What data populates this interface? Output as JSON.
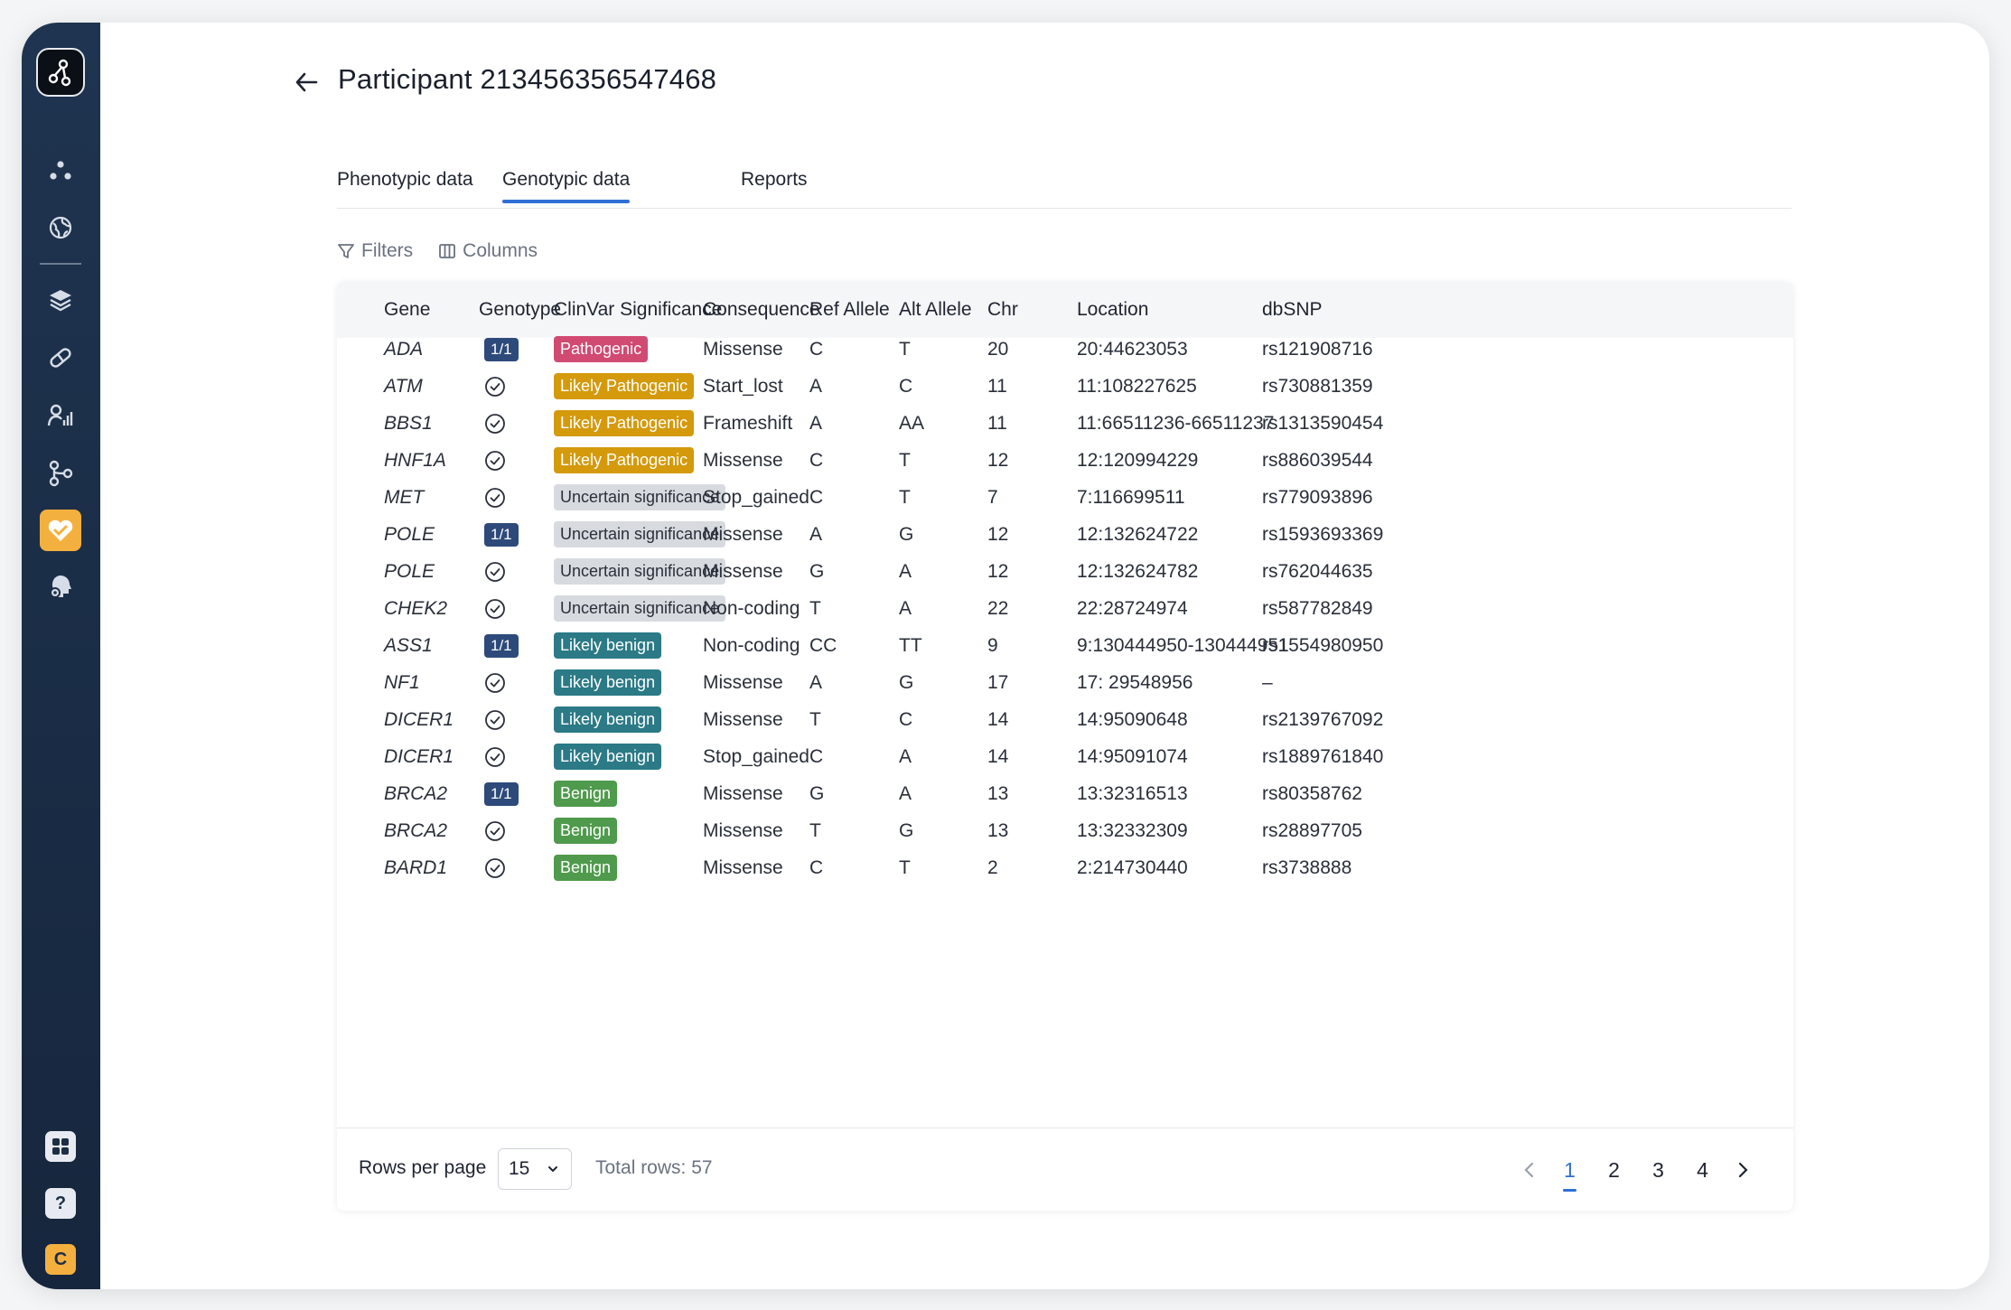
{
  "header": {
    "title": "Participant 213456356547468"
  },
  "tabs": [
    {
      "label": "Phenotypic data",
      "active": false
    },
    {
      "label": "Genotypic data",
      "active": true
    },
    {
      "label": "Reports",
      "active": false
    }
  ],
  "toolbar": {
    "filters_label": "Filters",
    "columns_label": "Columns"
  },
  "sidebar": {
    "items": [
      {
        "icon": "dots-cluster-icon"
      },
      {
        "icon": "globe-icon"
      },
      {
        "icon": "layers-icon"
      },
      {
        "icon": "pill-icon"
      },
      {
        "icon": "person-chart-icon"
      },
      {
        "icon": "branch-icon"
      },
      {
        "icon": "heart-shield-icon",
        "active": true
      },
      {
        "icon": "head-gear-icon"
      }
    ],
    "bottom": {
      "grid_icon": "grid-icon",
      "help_label": "?",
      "user_initial": "C"
    }
  },
  "colors": {
    "Pathogenic": "#d14a72",
    "Likely Pathogenic": "#d49a0c",
    "Uncertain significance": "#d7dade",
    "Likely benign": "#2b7a86",
    "Benign": "#4f9a4c",
    "accent": "#2f6fd6"
  },
  "table": {
    "columns": [
      "Gene",
      "Genotype",
      "ClinVar Significance",
      "Consequence",
      "Ref Allele",
      "Alt Allele",
      "Chr",
      "Location",
      "dbSNP"
    ],
    "rows": [
      {
        "gene": "ADA",
        "genotype": "1/1",
        "clinvar": "Pathogenic",
        "consequence": "Missense",
        "ref": "C",
        "alt": "T",
        "chr": "20",
        "location": "20:44623053",
        "dbsnp": "rs121908716"
      },
      {
        "gene": "ATM",
        "genotype": "check",
        "clinvar": "Likely Pathogenic",
        "consequence": "Start_lost",
        "ref": "A",
        "alt": "C",
        "chr": "11",
        "location": "11:108227625",
        "dbsnp": "rs730881359"
      },
      {
        "gene": "BBS1",
        "genotype": "check",
        "clinvar": "Likely Pathogenic",
        "consequence": "Frameshift",
        "ref": "A",
        "alt": "AA",
        "chr": "11",
        "location": "11:66511236-66511237",
        "dbsnp": "rs1313590454"
      },
      {
        "gene": "HNF1A",
        "genotype": "check",
        "clinvar": "Likely Pathogenic",
        "consequence": "Missense",
        "ref": "C",
        "alt": "T",
        "chr": "12",
        "location": "12:120994229",
        "dbsnp": "rs886039544"
      },
      {
        "gene": "MET",
        "genotype": "check",
        "clinvar": "Uncertain significance",
        "consequence": "Stop_gained",
        "ref": "C",
        "alt": "T",
        "chr": "7",
        "location": "7:116699511",
        "dbsnp": "rs779093896"
      },
      {
        "gene": "POLE",
        "genotype": "1/1",
        "clinvar": "Uncertain significance",
        "consequence": "Missense",
        "ref": "A",
        "alt": "G",
        "chr": "12",
        "location": "12:132624722",
        "dbsnp": "rs1593693369"
      },
      {
        "gene": "POLE",
        "genotype": "check",
        "clinvar": "Uncertain significance",
        "consequence": "Missense",
        "ref": "G",
        "alt": "A",
        "chr": "12",
        "location": "12:132624782",
        "dbsnp": "rs762044635"
      },
      {
        "gene": "CHEK2",
        "genotype": "check",
        "clinvar": "Uncertain significance",
        "consequence": "Non-coding",
        "ref": "T",
        "alt": "A",
        "chr": "22",
        "location": "22:28724974",
        "dbsnp": "rs587782849"
      },
      {
        "gene": "ASS1",
        "genotype": "1/1",
        "clinvar": "Likely benign",
        "consequence": "Non-coding",
        "ref": "CC",
        "alt": "TT",
        "chr": "9",
        "location": "9:130444950-130444951",
        "dbsnp": "rs1554980950"
      },
      {
        "gene": "NF1",
        "genotype": "check",
        "clinvar": "Likely benign",
        "consequence": "Missense",
        "ref": "A",
        "alt": "G",
        "chr": "17",
        "location": "17: 29548956",
        "dbsnp": "–"
      },
      {
        "gene": "DICER1",
        "genotype": "check",
        "clinvar": "Likely benign",
        "consequence": "Missense",
        "ref": "T",
        "alt": "C",
        "chr": "14",
        "location": "14:95090648",
        "dbsnp": "rs2139767092"
      },
      {
        "gene": "DICER1",
        "genotype": "check",
        "clinvar": "Likely benign",
        "consequence": "Stop_gained",
        "ref": "C",
        "alt": "A",
        "chr": "14",
        "location": "14:95091074",
        "dbsnp": "rs1889761840"
      },
      {
        "gene": "BRCA2",
        "genotype": "1/1",
        "clinvar": "Benign",
        "consequence": "Missense",
        "ref": "G",
        "alt": "A",
        "chr": "13",
        "location": "13:32316513",
        "dbsnp": "rs80358762"
      },
      {
        "gene": "BRCA2",
        "genotype": "check",
        "clinvar": "Benign",
        "consequence": "Missense",
        "ref": "T",
        "alt": "G",
        "chr": "13",
        "location": "13:32332309",
        "dbsnp": "rs28897705"
      },
      {
        "gene": "BARD1",
        "genotype": "check",
        "clinvar": "Benign",
        "consequence": "Missense",
        "ref": "C",
        "alt": "T",
        "chr": "2",
        "location": "2:214730440",
        "dbsnp": "rs3738888"
      }
    ]
  },
  "footer": {
    "rows_per_page_label": "Rows per page",
    "rows_per_page_value": "15",
    "total_rows_label": "Total rows: 57",
    "pages": [
      "1",
      "2",
      "3",
      "4"
    ],
    "current_page": "1"
  }
}
